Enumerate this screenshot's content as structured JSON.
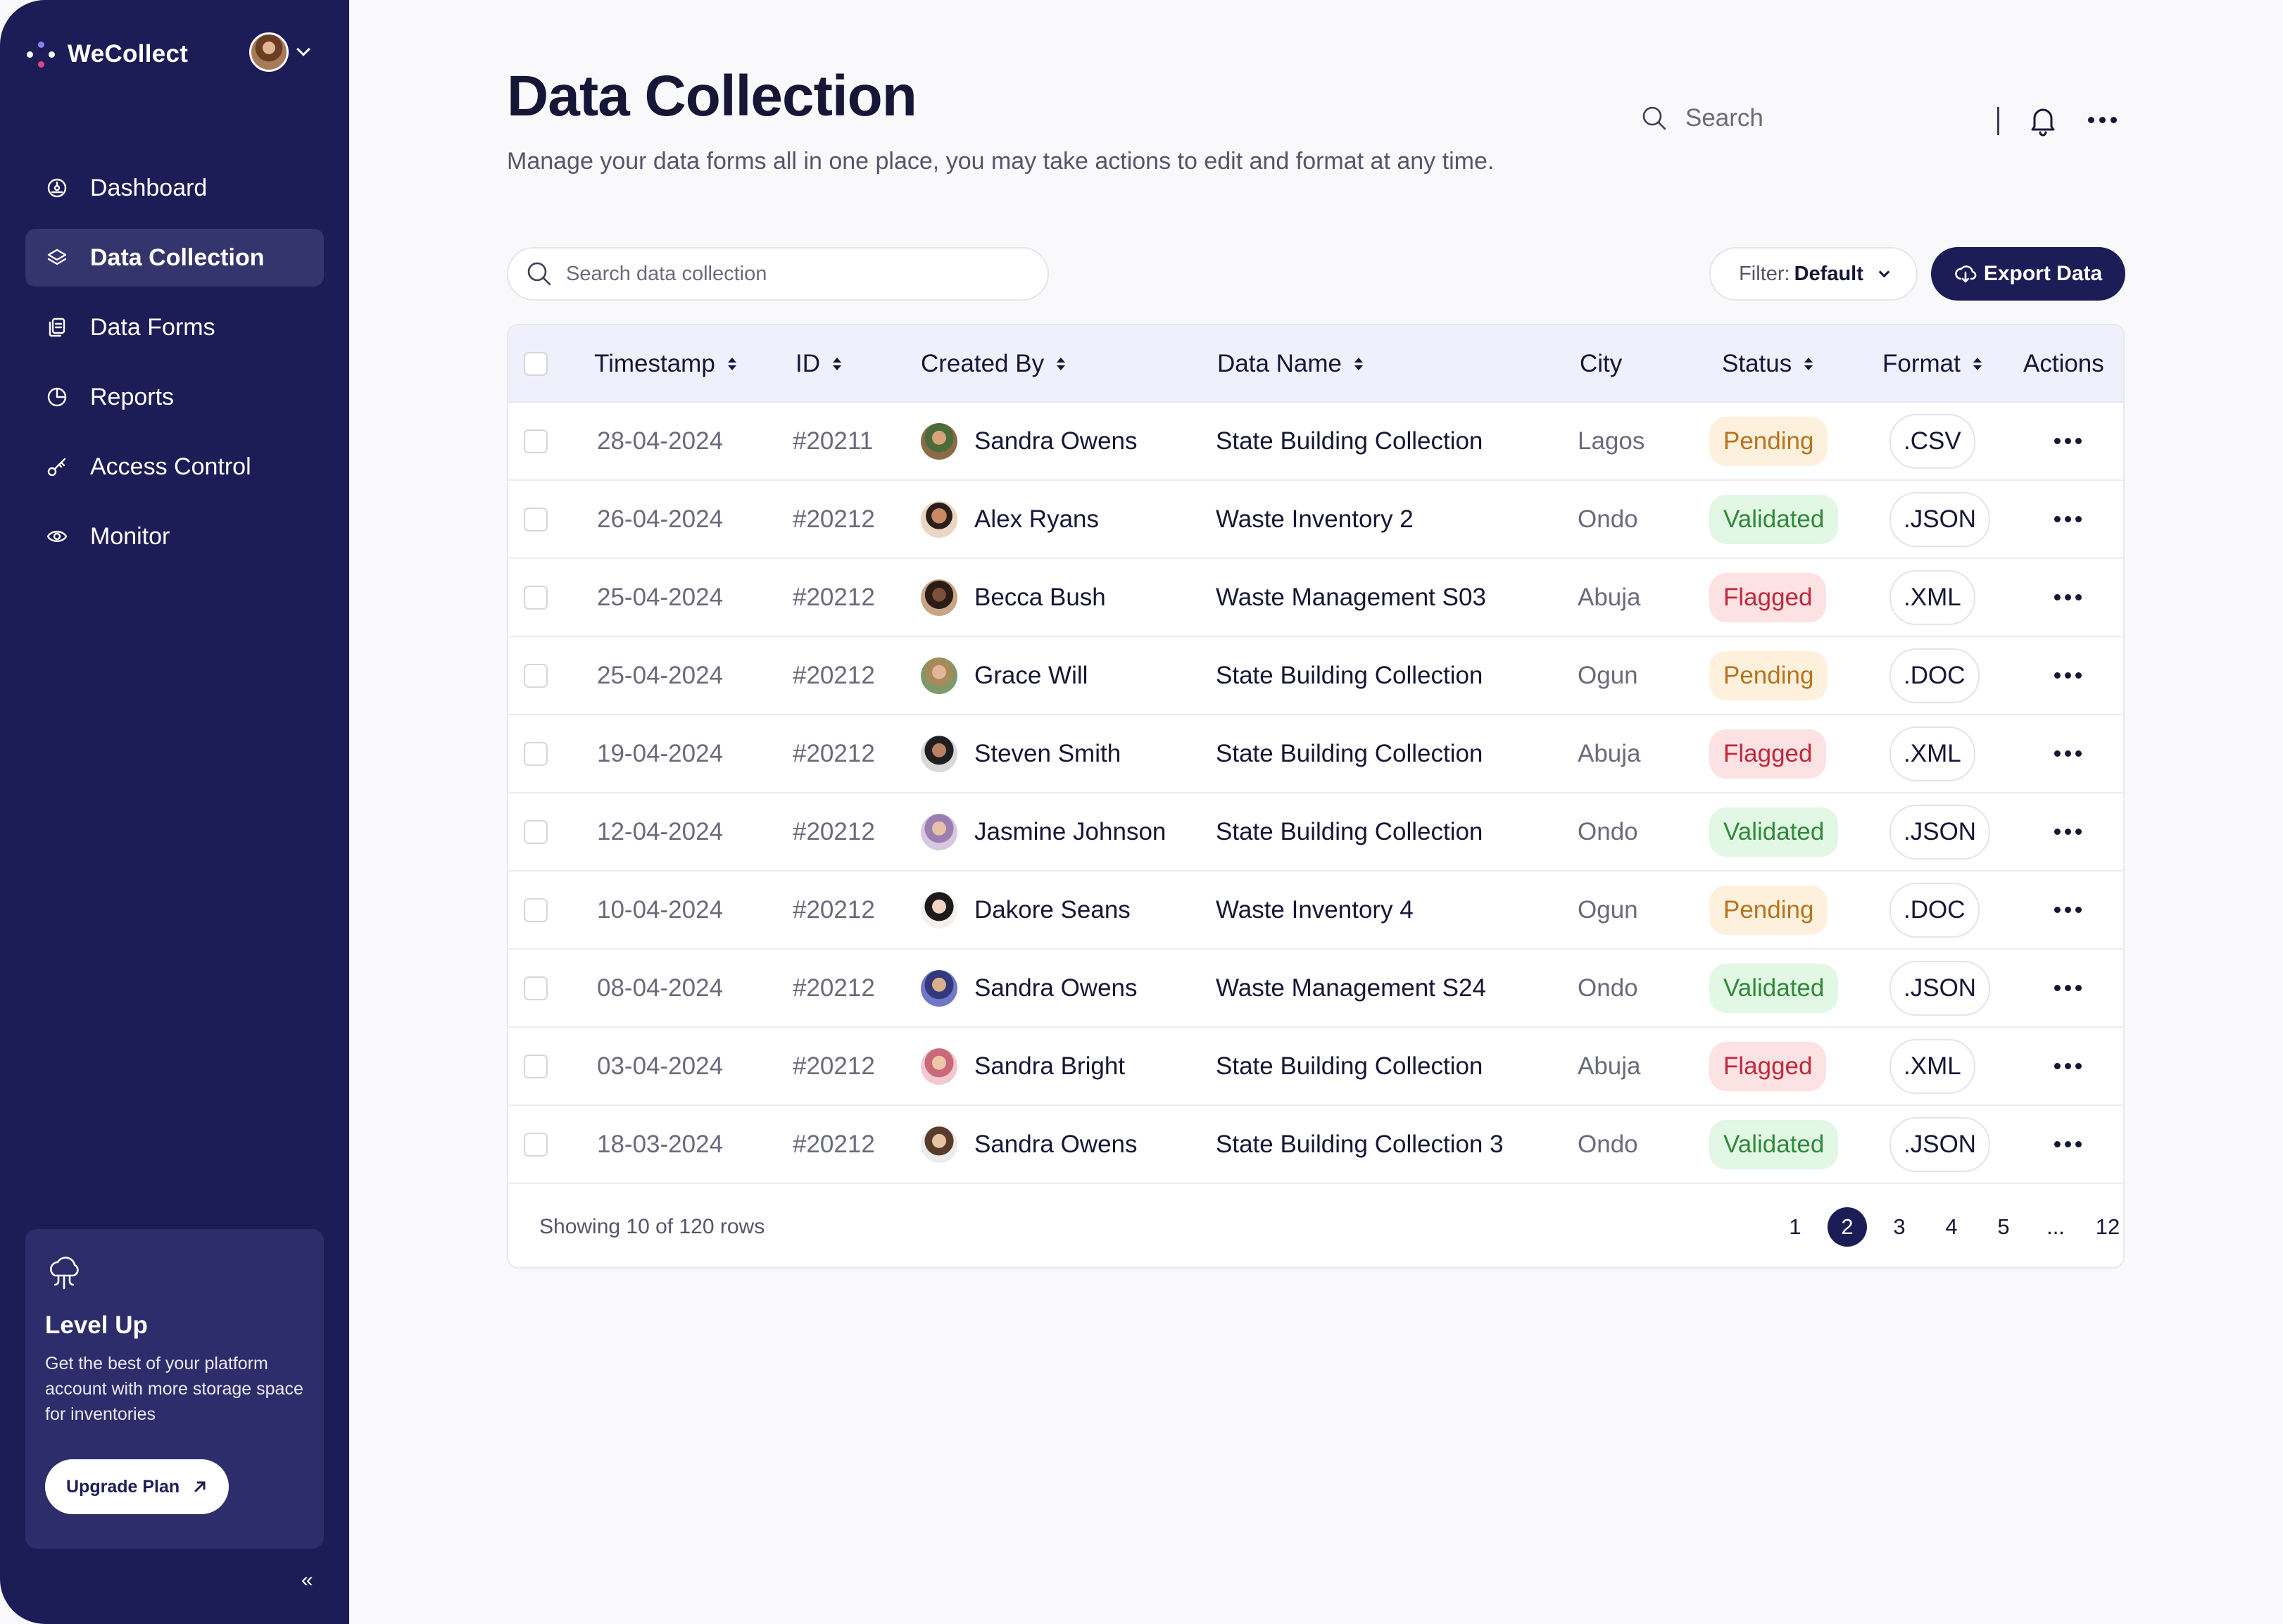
{
  "app": {
    "brand": "WeCollect"
  },
  "sidebar": {
    "items": [
      {
        "label": "Dashboard",
        "icon": "dashboard-icon",
        "active": false
      },
      {
        "label": "Data Collection",
        "icon": "layers-icon",
        "active": true
      },
      {
        "label": "Data Forms",
        "icon": "files-icon",
        "active": false
      },
      {
        "label": "Reports",
        "icon": "pie-chart-icon",
        "active": false
      },
      {
        "label": "Access Control",
        "icon": "key-icon",
        "active": false
      },
      {
        "label": "Monitor",
        "icon": "eye-icon",
        "active": false
      }
    ],
    "upgrade": {
      "title": "Level Up",
      "text": "Get the best of your platform account with more storage space for inventories",
      "button": "Upgrade Plan"
    },
    "collapse": "«"
  },
  "header": {
    "title": "Data Collection",
    "subtitle": "Manage your data forms all in one place, you may take actions to edit and format at any time.",
    "search_label": "Search"
  },
  "toolbar": {
    "search_placeholder": "Search data collection",
    "filter_label": "Filter:",
    "filter_value": "Default",
    "export_label": "Export Data"
  },
  "table": {
    "columns": [
      "Timestamp",
      "ID",
      "Created By",
      "Data Name",
      "City",
      "Status",
      "Format",
      "Actions"
    ],
    "rows": [
      {
        "timestamp": "28-04-2024",
        "id": "#20211",
        "created_by": "Sandra Owens",
        "data_name": "State Building Collection",
        "city": "Lagos",
        "status": "Pending",
        "format": ".CSV"
      },
      {
        "timestamp": "26-04-2024",
        "id": "#20212",
        "created_by": "Alex Ryans",
        "data_name": "Waste Inventory 2",
        "city": "Ondo",
        "status": "Validated",
        "format": ".JSON"
      },
      {
        "timestamp": "25-04-2024",
        "id": "#20212",
        "created_by": "Becca Bush",
        "data_name": "Waste Management S03",
        "city": "Abuja",
        "status": "Flagged",
        "format": ".XML"
      },
      {
        "timestamp": "25-04-2024",
        "id": "#20212",
        "created_by": "Grace Will",
        "data_name": "State Building Collection",
        "city": "Ogun",
        "status": "Pending",
        "format": ".DOC"
      },
      {
        "timestamp": "19-04-2024",
        "id": "#20212",
        "created_by": "Steven Smith",
        "data_name": "State Building Collection",
        "city": "Abuja",
        "status": "Flagged",
        "format": ".XML"
      },
      {
        "timestamp": "12-04-2024",
        "id": "#20212",
        "created_by": "Jasmine Johnson",
        "data_name": "State Building Collection",
        "city": "Ondo",
        "status": "Validated",
        "format": ".JSON"
      },
      {
        "timestamp": "10-04-2024",
        "id": "#20212",
        "created_by": "Dakore Seans",
        "data_name": "Waste Inventory 4",
        "city": "Ogun",
        "status": "Pending",
        "format": ".DOC"
      },
      {
        "timestamp": "08-04-2024",
        "id": "#20212",
        "created_by": "Sandra Owens",
        "data_name": "Waste Management S24",
        "city": "Ondo",
        "status": "Validated",
        "format": ".JSON"
      },
      {
        "timestamp": "03-04-2024",
        "id": "#20212",
        "created_by": "Sandra Bright",
        "data_name": "State Building Collection",
        "city": "Abuja",
        "status": "Flagged",
        "format": ".XML"
      },
      {
        "timestamp": "18-03-2024",
        "id": "#20212",
        "created_by": "Sandra Owens",
        "data_name": "State Building Collection 3",
        "city": "Ondo",
        "status": "Validated",
        "format": ".JSON"
      }
    ],
    "footer": "Showing 10 of 120 rows",
    "pages": [
      "1",
      "2",
      "3",
      "4",
      "5",
      "...",
      "12"
    ],
    "current_page": "2"
  },
  "colors": {
    "sidebar": "#1c1c57",
    "accent": "#1c1c57",
    "pending_bg": "#fdf1de",
    "pending_fg": "#b7731d",
    "validated_bg": "#e2f7e4",
    "validated_fg": "#2f8a3a",
    "flagged_bg": "#fde2e4",
    "flagged_fg": "#c0283a"
  }
}
